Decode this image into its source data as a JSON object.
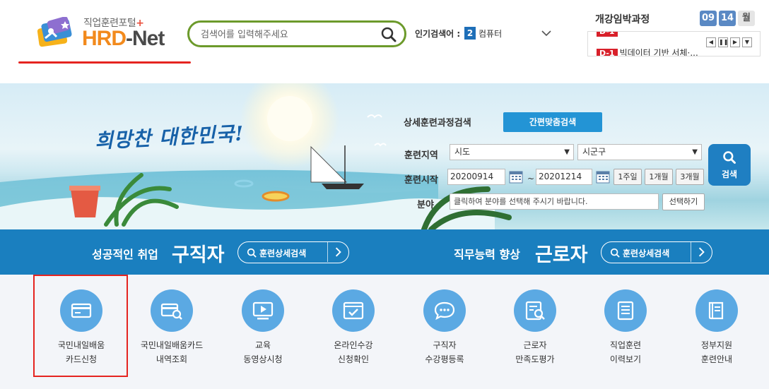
{
  "header": {
    "logo": {
      "sub": "직업훈련포털",
      "sub_plus": "+",
      "main_a": "HRD",
      "main_b": "-Net"
    },
    "search": {
      "placeholder": "검색어를 입력해주세요"
    },
    "popular": {
      "label": "인기검색어 :",
      "rank": "2",
      "word": "컴퓨터"
    },
    "courses": {
      "title": "개강임박과정",
      "date": {
        "month": "09",
        "day": "14",
        "dow": "월"
      },
      "items": [
        {
          "dday": "D-1",
          "text": "빅데이터 기반 서체·..."
        }
      ],
      "faded_text": "─ ─ ─ ─ ─ ─"
    }
  },
  "banner": {
    "slogan": "희망찬 대한민국!",
    "form_title": "상세훈련과정검색",
    "custom_button": "간편맞춤검색",
    "labels": {
      "region": "훈련지역",
      "start": "훈련시작",
      "field": "분야"
    },
    "region": {
      "sido": "시도",
      "sigungu": "시군구"
    },
    "start_date": "20200914",
    "end_date": "20201214",
    "tilde": "~",
    "periods": [
      "1주일",
      "1개월",
      "3개월"
    ],
    "field_placeholder": "클릭하여 분야를 선택해 주시기 바랍니다.",
    "pick_button": "선택하기",
    "search_button": "검색"
  },
  "strip": {
    "left": {
      "small": "성공적인 취업",
      "big": "구직자",
      "pill": "훈련상세검색"
    },
    "right": {
      "small": "직무능력 향상",
      "big": "근로자",
      "pill": "훈련상세검색"
    }
  },
  "quick_menu": [
    {
      "icon": "card-icon",
      "line1": "국민내일배움",
      "line2": "카드신청"
    },
    {
      "icon": "card-search-icon",
      "line1": "국민내일배움카드",
      "line2": "내역조회"
    },
    {
      "icon": "video-play-icon",
      "line1": "교육",
      "line2": "동영상시청"
    },
    {
      "icon": "browser-check-icon",
      "line1": "온라인수강",
      "line2": "신청확인"
    },
    {
      "icon": "speech-bubble-icon",
      "line1": "구직자",
      "line2": "수강평등록"
    },
    {
      "icon": "document-search-icon",
      "line1": "근로자",
      "line2": "만족도평가"
    },
    {
      "icon": "document-list-icon",
      "line1": "직업훈련",
      "line2": "이력보기"
    },
    {
      "icon": "book-icon",
      "line1": "정부지원",
      "line2": "훈련안내"
    }
  ],
  "colors": {
    "brand_orange": "#f28a1d",
    "primary_blue": "#1a7fbf",
    "search_green": "#6c9a2b",
    "highlight_red": "#e52420",
    "quick_icon_blue": "#5ba9e3"
  }
}
